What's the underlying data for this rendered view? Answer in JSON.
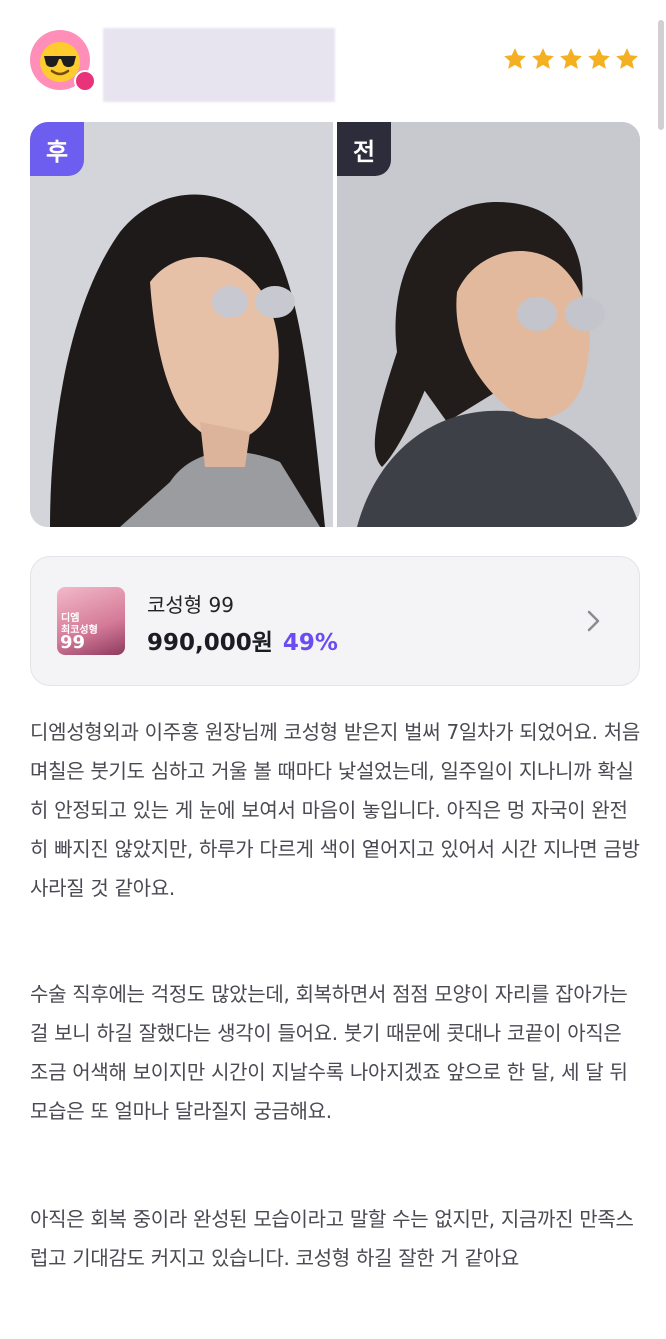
{
  "header": {
    "avatar_icon": "sunglasses-emoji-icon",
    "rating": 5,
    "accent_color": "#f5b021"
  },
  "photos": {
    "after_label": "후",
    "before_label": "전"
  },
  "product": {
    "name": "코성형 99",
    "price": "990,000원",
    "discount": "49%",
    "thumb_text_1": "디엠",
    "thumb_text_2": "최코성형",
    "thumb_number": "99"
  },
  "review": {
    "paragraph_1": "디엠성형외과 이주홍 원장님께 코성형 받은지 벌써 7일차가 되었어요. 처음 며칠은 붓기도 심하고 거울 볼 때마다 낯설었는데, 일주일이 지나니까 확실히 안정되고 있는 게 눈에 보여서 마음이 놓입니다. 아직은 멍 자국이 완전히 빠지진 않았지만, 하루가 다르게 색이 옅어지고 있어서 시간 지나면 금방 사라질 것 같아요.",
    "paragraph_2": "수술 직후에는 걱정도 많았는데, 회복하면서 점점 모양이 자리를 잡아가는 걸 보니 하길 잘했다는 생각이 들어요. 붓기 때문에 콧대나 코끝이 아직은 조금 어색해 보이지만 시간이 지날수록 나아지겠죠 앞으로 한 달, 세 달 뒤 모습은 또 얼마나 달라질지 궁금해요.",
    "paragraph_3": "아직은 회복 중이라 완성된 모습이라고 말할 수는 없지만, 지금까진 만족스럽고 기대감도 커지고 있습니다. 코성형 하길 잘한 거 같아요"
  }
}
